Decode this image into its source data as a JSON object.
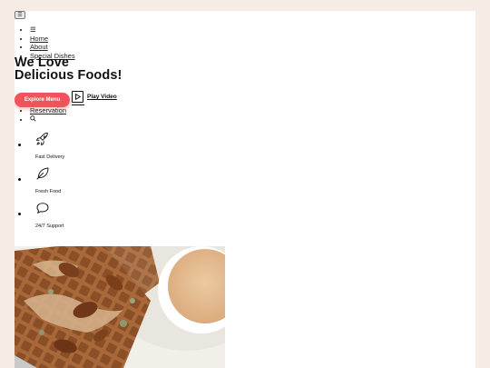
{
  "menu_toggle": {
    "label": "☰"
  },
  "nav": {
    "items": [
      {
        "label": "☰"
      },
      {
        "label": "Home"
      },
      {
        "label": "About"
      },
      {
        "label": "Special Dishes"
      }
    ],
    "items_after": [
      {
        "label": "Reservation"
      },
      {
        "label": "search-icon"
      }
    ]
  },
  "hero": {
    "title_line1": "We Love",
    "title_line2": "Delicious Foods!",
    "explore_label": "Explore Menu",
    "play_label": "Play Video"
  },
  "features": [
    {
      "icon": "rocket-icon",
      "label": "Fast Delivery"
    },
    {
      "icon": "leaf-icon",
      "label": "Fresh Food"
    },
    {
      "icon": "chat-bubble-icon",
      "label": "24/7 Support"
    }
  ],
  "colors": {
    "accent": "#f0535a",
    "page_background": "#f5ece6",
    "card_background": "#ffffff"
  },
  "image": {
    "subject": "waffles-with-pecans-and-dip"
  }
}
